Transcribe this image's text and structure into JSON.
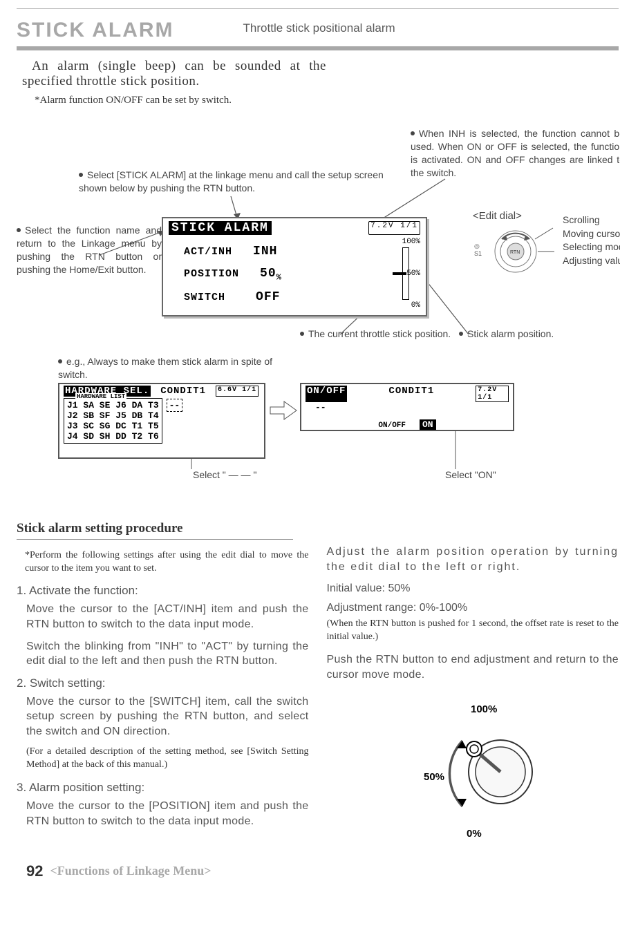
{
  "header": {
    "title": "STICK ALARM",
    "subtitle": "Throttle stick positional alarm"
  },
  "intro": {
    "text": "An alarm (single beep) can be sounded at the specified throttle stick position.",
    "note": "*Alarm function ON/OFF can be set by switch."
  },
  "callouts": {
    "select_menu": "Select [STICK ALARM] at the linkage menu and call the setup screen shown below by pushing the RTN button.",
    "inh_explain": "When INH is selected, the function cannot be used. When ON or OFF is selected, the function is activated. ON and OFF changes are linked to the switch.",
    "return_menu": "Select the function name and return to the Linkage menu by pushing the RTN button or pushing the Home/Exit button.",
    "current_pos": "The current throttle stick position.",
    "stick_pos": "Stick alarm position.",
    "always": "e.g., Always to make them stick alarm in spite of switch.",
    "edit_dial": "<Edit dial>",
    "dial_main": "Scrolling",
    "dial_b1": "Moving cursor",
    "dial_b2": "Selecting mode",
    "dial_b3": "Adjusting value",
    "select_dashes": "Select \" — — \"",
    "select_on": "Select \"ON\""
  },
  "lcd_main": {
    "title": "STICK ALARM",
    "batt": "7.2V",
    "page": "1/1",
    "row1_label": "ACT/INH",
    "row1_val": "INH",
    "row2_label": "POSITION",
    "row2_val": "50",
    "row2_unit": "%",
    "row3_label": "SWITCH",
    "row3_val": "OFF",
    "scale_top": "100%",
    "scale_mid": "50%",
    "scale_bot": "0%"
  },
  "lcd_hw": {
    "title": "HARDWARE SEL.",
    "cond": "CONDIT1",
    "batt": "6.6V",
    "page": "1/1",
    "rows": [
      "J1 SA SE J6 DA T3",
      "J2 SB SF J5 DB T4",
      "J3 SC SG DC T1 T5",
      "J4 SD SH DD T2 T6"
    ],
    "dash": "--"
  },
  "lcd_on": {
    "title": "ON/OFF",
    "cond": "CONDIT1",
    "batt": "7.2V",
    "page": "1/1",
    "dash": "--",
    "label": "ON/OFF",
    "val": "ON"
  },
  "procedure": {
    "heading": "Stick alarm setting procedure",
    "pre_note": "*Perform the following settings after using the edit dial to move the cursor to the item you want to set.",
    "s1_h": "1. Activate the function:",
    "s1_b1": "Move the cursor to the [ACT/INH] item and push the RTN button to switch to the data input mode.",
    "s1_b2": "Switch the blinking from \"INH\" to \"ACT\" by turning the edit dial to the left and then push the RTN button.",
    "s2_h": "2. Switch setting:",
    "s2_b1": "Move the cursor to the [SWITCH] item, call the switch setup screen by pushing the RTN button, and select the switch and ON direction.",
    "s2_note": "(For a detailed description of the setting method, see [Switch Setting Method] at the back of this manual.)",
    "s3_h": "3. Alarm position setting:",
    "s3_b1": "Move the cursor to the [POSITION] item and push the RTN button to switch to the data input mode.",
    "right1": "Adjust the alarm position operation by turning the edit dial to the left or right.",
    "right2": "Initial value: 50%",
    "right3": "Adjustment range: 0%-100%",
    "right_note": "(When the RTN button is pushed for 1 second, the offset rate is reset to the initial value.)",
    "right4": "Push the RTN button to end adjustment and return to the cursor move mode."
  },
  "stick_labels": {
    "top": "100%",
    "mid": "50%",
    "bot": "0%"
  },
  "footer": {
    "page": "92",
    "section": "<Functions of Linkage Menu>"
  }
}
